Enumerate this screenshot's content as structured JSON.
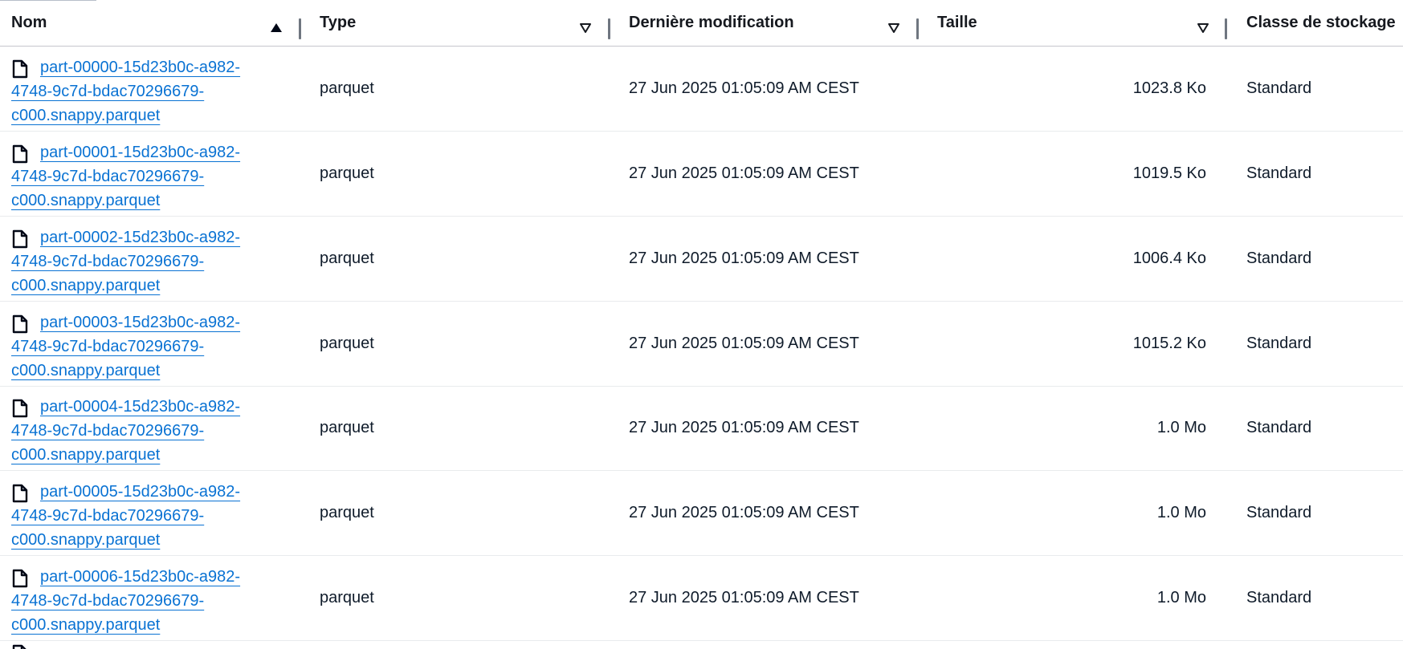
{
  "columns": {
    "name": "Nom",
    "type": "Type",
    "modified": "Dernière modification",
    "size": "Taille",
    "storage_class": "Classe de stockage"
  },
  "rows": [
    {
      "name_lines": [
        "part-00000-15d23b0c-a982-",
        "4748-9c7d-bdac70296679-",
        "c000.snappy.parquet"
      ],
      "type": "parquet",
      "modified": "27 Jun 2025 01:05:09 AM CEST",
      "size": "1023.8 Ko",
      "storage_class": "Standard"
    },
    {
      "name_lines": [
        "part-00001-15d23b0c-a982-",
        "4748-9c7d-bdac70296679-",
        "c000.snappy.parquet"
      ],
      "type": "parquet",
      "modified": "27 Jun 2025 01:05:09 AM CEST",
      "size": "1019.5 Ko",
      "storage_class": "Standard"
    },
    {
      "name_lines": [
        "part-00002-15d23b0c-a982-",
        "4748-9c7d-bdac70296679-",
        "c000.snappy.parquet"
      ],
      "type": "parquet",
      "modified": "27 Jun 2025 01:05:09 AM CEST",
      "size": "1006.4 Ko",
      "storage_class": "Standard"
    },
    {
      "name_lines": [
        "part-00003-15d23b0c-a982-",
        "4748-9c7d-bdac70296679-",
        "c000.snappy.parquet"
      ],
      "type": "parquet",
      "modified": "27 Jun 2025 01:05:09 AM CEST",
      "size": "1015.2 Ko",
      "storage_class": "Standard"
    },
    {
      "name_lines": [
        "part-00004-15d23b0c-a982-",
        "4748-9c7d-bdac70296679-",
        "c000.snappy.parquet"
      ],
      "type": "parquet",
      "modified": "27 Jun 2025 01:05:09 AM CEST",
      "size": "1.0 Mo",
      "storage_class": "Standard"
    },
    {
      "name_lines": [
        "part-00005-15d23b0c-a982-",
        "4748-9c7d-bdac70296679-",
        "c000.snappy.parquet"
      ],
      "type": "parquet",
      "modified": "27 Jun 2025 01:05:09 AM CEST",
      "size": "1.0 Mo",
      "storage_class": "Standard"
    },
    {
      "name_lines": [
        "part-00006-15d23b0c-a982-",
        "4748-9c7d-bdac70296679-",
        "c000.snappy.parquet"
      ],
      "type": "parquet",
      "modified": "27 Jun 2025 01:05:09 AM CEST",
      "size": "1.0 Mo",
      "storage_class": "Standard"
    }
  ],
  "sort": {
    "column": "name",
    "direction": "ascending"
  },
  "colors": {
    "link": "#0972d3",
    "text": "#0f1b2a",
    "header_text": "#16191f",
    "divider": "#6f7680",
    "row_border": "#e9ebed"
  },
  "icons": {
    "file": "file-icon",
    "sort_ascending": "sort-ascending-icon",
    "sort_inactive": "sort-caret-down-icon"
  }
}
